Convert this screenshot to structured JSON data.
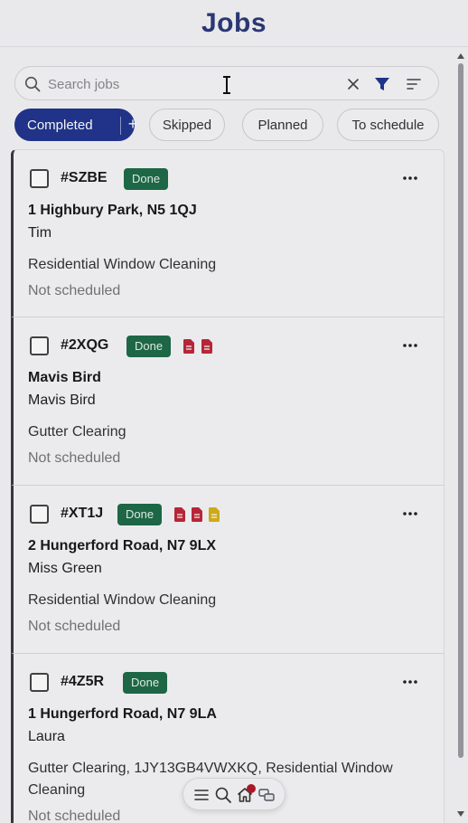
{
  "header": {
    "title": "Jobs"
  },
  "search": {
    "placeholder": "Search jobs"
  },
  "filters": {
    "active": {
      "label": "Completed",
      "add_label": "+"
    },
    "chips": [
      {
        "label": "Skipped"
      },
      {
        "label": "Planned"
      },
      {
        "label": "To schedule"
      }
    ]
  },
  "jobs": [
    {
      "id": "#SZBE",
      "status": "Done",
      "docs": [],
      "address": "1 Highbury Park, N5 1QJ",
      "client": "Tim",
      "service": "Residential Window Cleaning",
      "schedule": "Not scheduled"
    },
    {
      "id": "#2XQG",
      "status": "Done",
      "docs": [
        "red",
        "red"
      ],
      "address": "Mavis Bird",
      "client": "Mavis Bird",
      "service": "Gutter Clearing",
      "schedule": "Not scheduled"
    },
    {
      "id": "#XT1J",
      "status": "Done",
      "docs": [
        "red",
        "red",
        "yellow"
      ],
      "address": "2 Hungerford Road, N7 9LX",
      "client": "Miss Green",
      "service": "Residential Window Cleaning",
      "schedule": "Not scheduled"
    },
    {
      "id": "#4Z5R",
      "status": "Done",
      "docs": [],
      "address": "1 Hungerford Road, N7 9LA",
      "client": "Laura",
      "service": "Gutter Clearing, 1JY13GB4VWXKQ, Residential Window Cleaning",
      "schedule": "Not scheduled"
    }
  ],
  "colors": {
    "brand": "#22368f",
    "done_badge": "#1f6b4a",
    "doc_red": "#c0283a",
    "doc_yellow": "#d8b21a",
    "notification": "#b11a2a"
  },
  "icons": {
    "search": "search-icon",
    "clear": "close-icon",
    "filter": "funnel-icon",
    "sort": "sort-icon",
    "more": "more-horizontal-icon",
    "menu": "menu-icon",
    "home": "home-icon",
    "chat": "chat-icon"
  }
}
